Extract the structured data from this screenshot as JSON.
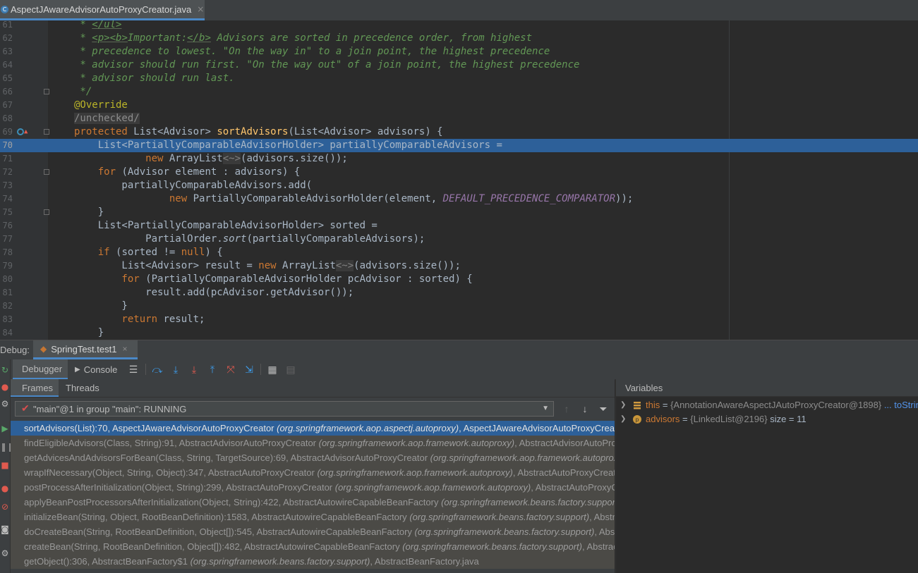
{
  "editor_tab": {
    "filename": "AspectJAwareAdvisorAutoProxyCreator.java",
    "close": "×"
  },
  "code": {
    "lines": [
      {
        "n": "61",
        "segs": [
          [
            "cm",
            " * "
          ],
          [
            "tg",
            "</ul>"
          ]
        ]
      },
      {
        "n": "62",
        "segs": [
          [
            "cm",
            " * "
          ],
          [
            "tg",
            "<p><b>"
          ],
          [
            "cm",
            "Important:"
          ],
          [
            "tg",
            "</b>"
          ],
          [
            "cm",
            " Advisors are sorted in precedence order, from highest"
          ]
        ]
      },
      {
        "n": "63",
        "segs": [
          [
            "cm",
            " * precedence to lowest. \"On the way in\" to a join point, the highest precedence"
          ]
        ]
      },
      {
        "n": "64",
        "segs": [
          [
            "cm",
            " * advisor should run first. \"On the way out\" of a join point, the highest precedence"
          ]
        ]
      },
      {
        "n": "65",
        "segs": [
          [
            "cm",
            " * advisor should run last."
          ]
        ]
      },
      {
        "n": "66",
        "segs": [
          [
            "cm",
            " */"
          ]
        ]
      },
      {
        "n": "67",
        "segs": [
          [
            "an",
            "@Override"
          ]
        ]
      },
      {
        "n": "68",
        "segs": [
          [
            "dm",
            "/unchecked/"
          ]
        ]
      },
      {
        "n": "69",
        "segs": [
          [
            "kw",
            "protected "
          ],
          [
            "tx",
            "List<Advisor> "
          ],
          [
            "fn",
            "sortAdvisors"
          ],
          [
            "tx",
            "(List<Advisor> advisors) {"
          ]
        ]
      },
      {
        "n": "70",
        "segs": [
          [
            "tx",
            "    List<PartiallyComparableAdvisorHolder> partiallyComparableAdvisors ="
          ]
        ]
      },
      {
        "n": "71",
        "segs": [
          [
            "tx",
            "            "
          ],
          [
            "kw",
            "new "
          ],
          [
            "tx",
            "ArrayList"
          ],
          [
            "ph",
            "<~>"
          ],
          [
            "tx",
            "(advisors.size());"
          ]
        ]
      },
      {
        "n": "72",
        "segs": [
          [
            "kw",
            "    for "
          ],
          [
            "tx",
            "(Advisor element : advisors) {"
          ]
        ]
      },
      {
        "n": "73",
        "segs": [
          [
            "tx",
            "        partiallyComparableAdvisors.add("
          ]
        ]
      },
      {
        "n": "74",
        "segs": [
          [
            "tx",
            "                "
          ],
          [
            "kw",
            "new "
          ],
          [
            "tx",
            "PartiallyComparableAdvisorHolder(element, "
          ],
          [
            "st",
            "DEFAULT_PRECEDENCE_COMPARATOR"
          ],
          [
            "tx",
            "));"
          ]
        ]
      },
      {
        "n": "75",
        "segs": [
          [
            "tx",
            "    }"
          ]
        ]
      },
      {
        "n": "76",
        "segs": [
          [
            "tx",
            "    List<PartiallyComparableAdvisorHolder> sorted ="
          ]
        ]
      },
      {
        "n": "77",
        "segs": [
          [
            "tx",
            "            PartialOrder."
          ],
          [
            "ai",
            "sort"
          ],
          [
            "tx",
            "(partiallyComparableAdvisors);"
          ]
        ]
      },
      {
        "n": "78",
        "segs": [
          [
            "kw",
            "    if "
          ],
          [
            "tx",
            "(sorted != "
          ],
          [
            "kw",
            "null"
          ],
          [
            "tx",
            ") {"
          ]
        ]
      },
      {
        "n": "79",
        "segs": [
          [
            "tx",
            "        List<Advisor> result = "
          ],
          [
            "kw",
            "new "
          ],
          [
            "tx",
            "ArrayList"
          ],
          [
            "ph",
            "<~>"
          ],
          [
            "tx",
            "(advisors.size());"
          ]
        ]
      },
      {
        "n": "80",
        "segs": [
          [
            "kw",
            "        for "
          ],
          [
            "tx",
            "(PartiallyComparableAdvisorHolder pcAdvisor : sorted) {"
          ]
        ]
      },
      {
        "n": "81",
        "segs": [
          [
            "tx",
            "            result.add(pcAdvisor.getAdvisor());"
          ]
        ]
      },
      {
        "n": "82",
        "segs": [
          [
            "tx",
            "        }"
          ]
        ]
      },
      {
        "n": "83",
        "segs": [
          [
            "kw",
            "        return "
          ],
          [
            "tx",
            "result;"
          ]
        ]
      },
      {
        "n": "84",
        "segs": [
          [
            "tx",
            "    }"
          ]
        ]
      }
    ]
  },
  "debug": {
    "label": "Debug:",
    "run_config": "SpringTest.test1",
    "tabs": {
      "debugger": "Debugger",
      "console": "Console"
    },
    "panel_tabs": {
      "frames": "Frames",
      "threads": "Threads"
    },
    "thread": "\"main\"@1 in group \"main\": RUNNING",
    "frames": [
      {
        "m": "sortAdvisors(List):70, AspectJAwareAdvisorAutoProxyCreator ",
        "p": "(org.springframework.aop.aspectj.autoproxy)",
        "s": ", AspectJAwareAdvisorAutoProxyCreator.java"
      },
      {
        "m": "findEligibleAdvisors(Class, String):91, AbstractAdvisorAutoProxyCreator ",
        "p": "(org.springframework.aop.framework.autoproxy)",
        "s": ", AbstractAdvisorAutoProxyCreator.java"
      },
      {
        "m": "getAdvicesAndAdvisorsForBean(Class, String, TargetSource):69, AbstractAdvisorAutoProxyCreator ",
        "p": "(org.springframework.aop.framework.autoproxy)",
        "s": ", AbstractAdvisorAutoProxyCreator.java"
      },
      {
        "m": "wrapIfNecessary(Object, String, Object):347, AbstractAutoProxyCreator ",
        "p": "(org.springframework.aop.framework.autoproxy)",
        "s": ", AbstractAutoProxyCreator.java"
      },
      {
        "m": "postProcessAfterInitialization(Object, String):299, AbstractAutoProxyCreator ",
        "p": "(org.springframework.aop.framework.autoproxy)",
        "s": ", AbstractAutoProxyCreator.java"
      },
      {
        "m": "applyBeanPostProcessorsAfterInitialization(Object, String):422, AbstractAutowireCapableBeanFactory ",
        "p": "(org.springframework.beans.factory.support)",
        "s": ", AbstractAutowireCapableBeanFactory.java"
      },
      {
        "m": "initializeBean(String, Object, RootBeanDefinition):1583, AbstractAutowireCapableBeanFactory ",
        "p": "(org.springframework.beans.factory.support)",
        "s": ", AbstractAutowireCapableBeanFactory.java"
      },
      {
        "m": "doCreateBean(String, RootBeanDefinition, Object[]):545, AbstractAutowireCapableBeanFactory ",
        "p": "(org.springframework.beans.factory.support)",
        "s": ", AbstractAutowireCapableBeanFactory.java"
      },
      {
        "m": "createBean(String, RootBeanDefinition, Object[]):482, AbstractAutowireCapableBeanFactory ",
        "p": "(org.springframework.beans.factory.support)",
        "s": ", AbstractAutowireCapableBeanFactory.java"
      },
      {
        "m": "getObject():306, AbstractBeanFactory$1 ",
        "p": "(org.springframework.beans.factory.support)",
        "s": ", AbstractBeanFactory.java"
      }
    ]
  },
  "variables": {
    "title": "Variables",
    "items": [
      {
        "name": "this",
        "eq": " = ",
        "value": "{AnnotationAwareAspectJAutoProxyCreator@1898}",
        "extra": " ... toString()",
        "icon": "field-icon"
      },
      {
        "name": "advisors",
        "eq": " = ",
        "value": "{LinkedList@2196}",
        "extra": "  size = 11",
        "icon": "parameter-icon"
      }
    ]
  }
}
